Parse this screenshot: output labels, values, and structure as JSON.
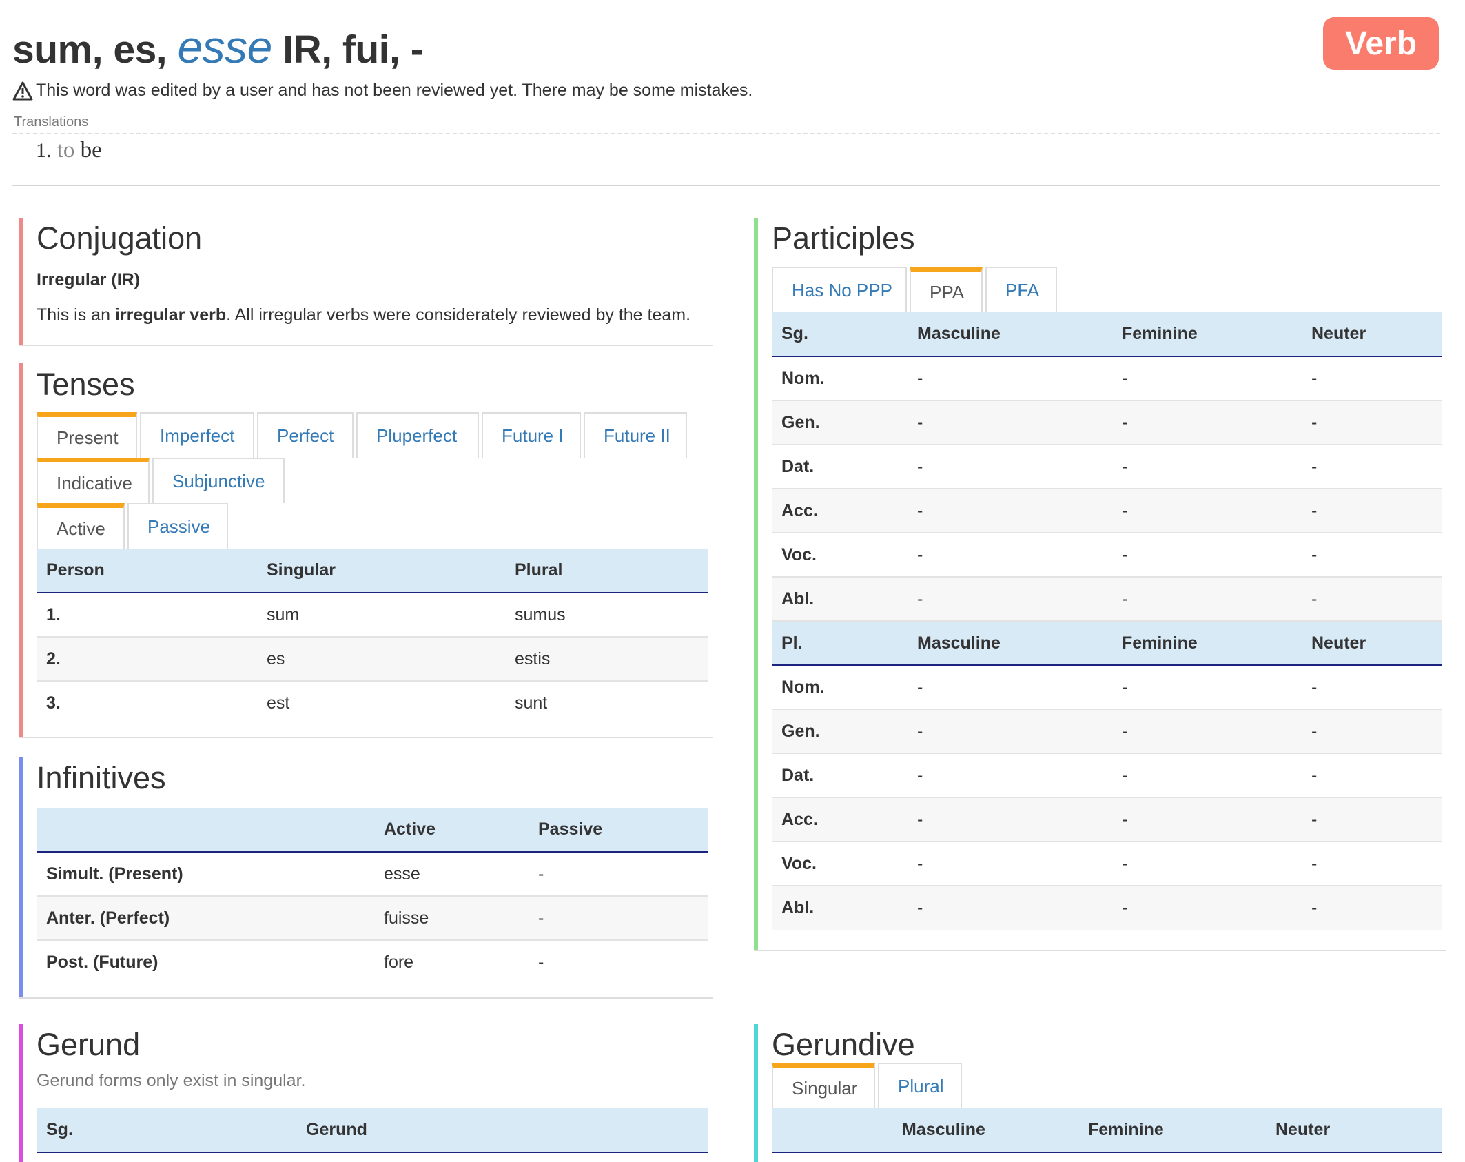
{
  "header": {
    "prefix": "sum, es, ",
    "infinitive": "esse",
    "suffix": " IR, fui, -",
    "badge": "Verb",
    "warning_icon": "warning-triangle-icon",
    "warning": "This word was edited by a user and has not been reviewed yet. There may be some mistakes.",
    "translations_label": "Translations",
    "translation_number": "1.",
    "translation_to": "to",
    "translation_word": "be"
  },
  "colors": {
    "badge": "#fa7c6d",
    "link": "#337ab7",
    "active_tab": "#f7a61b",
    "table_header": "#d9eaf7",
    "conjugation_bar": "#f08a8a",
    "tenses_bar": "#f08a8a",
    "infinitives_bar": "#7b8ef0",
    "gerund_bar": "#d94ee0",
    "participles_bar": "#8ee08e",
    "gerundive_bar": "#4fd6d6"
  },
  "conjugation": {
    "title": "Conjugation",
    "type": "Irregular (IR)",
    "desc_pre": "This is an ",
    "desc_bold": "irregular verb",
    "desc_post": ". All irregular verbs were considerately reviewed by the team."
  },
  "tenses": {
    "title": "Tenses",
    "tabs": [
      "Present",
      "Imperfect",
      "Perfect",
      "Pluperfect",
      "Future I",
      "Future II"
    ],
    "mood_tabs": [
      "Indicative",
      "Subjunctive"
    ],
    "voice_tabs": [
      "Active",
      "Passive"
    ],
    "headers": [
      "Person",
      "Singular",
      "Plural"
    ],
    "rows": [
      [
        "1.",
        "sum",
        "sumus"
      ],
      [
        "2.",
        "es",
        "estis"
      ],
      [
        "3.",
        "est",
        "sunt"
      ]
    ]
  },
  "infinitives": {
    "title": "Infinitives",
    "headers": [
      "",
      "Active",
      "Passive"
    ],
    "rows": [
      [
        "Simult. (Present)",
        "esse",
        "-"
      ],
      [
        "Anter. (Perfect)",
        "fuisse",
        "-"
      ],
      [
        "Post. (Future)",
        "fore",
        "-"
      ]
    ]
  },
  "gerund": {
    "title": "Gerund",
    "note": "Gerund forms only exist in singular.",
    "headers": [
      "Sg.",
      "Gerund"
    ]
  },
  "participles": {
    "title": "Participles",
    "tabs": [
      "Has No PPP",
      "PPA",
      "PFA"
    ],
    "sg_headers": [
      "Sg.",
      "Masculine",
      "Feminine",
      "Neuter"
    ],
    "pl_headers": [
      "Pl.",
      "Masculine",
      "Feminine",
      "Neuter"
    ],
    "sg_rows": [
      [
        "Nom.",
        "-",
        "-",
        "-"
      ],
      [
        "Gen.",
        "-",
        "-",
        "-"
      ],
      [
        "Dat.",
        "-",
        "-",
        "-"
      ],
      [
        "Acc.",
        "-",
        "-",
        "-"
      ],
      [
        "Voc.",
        "-",
        "-",
        "-"
      ],
      [
        "Abl.",
        "-",
        "-",
        "-"
      ]
    ],
    "pl_rows": [
      [
        "Nom.",
        "-",
        "-",
        "-"
      ],
      [
        "Gen.",
        "-",
        "-",
        "-"
      ],
      [
        "Dat.",
        "-",
        "-",
        "-"
      ],
      [
        "Acc.",
        "-",
        "-",
        "-"
      ],
      [
        "Voc.",
        "-",
        "-",
        "-"
      ],
      [
        "Abl.",
        "-",
        "-",
        "-"
      ]
    ]
  },
  "gerundive": {
    "title": "Gerundive",
    "tabs": [
      "Singular",
      "Plural"
    ],
    "headers": [
      "",
      "Masculine",
      "Feminine",
      "Neuter"
    ]
  }
}
